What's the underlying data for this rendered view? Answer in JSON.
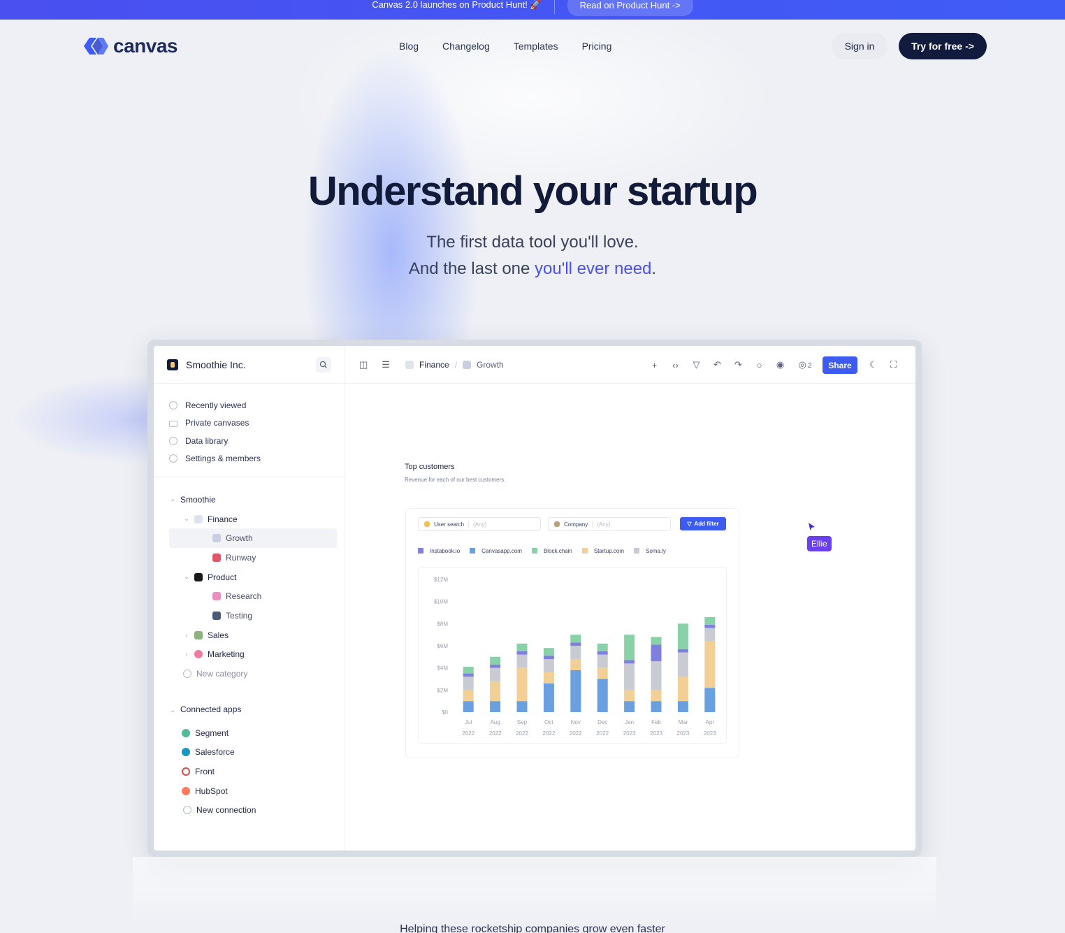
{
  "banner": {
    "announcement": "Canvas 2.0 launches on Product Hunt! 🚀",
    "cta": "Read on Product Hunt ->"
  },
  "nav": {
    "logo_text": "canvas",
    "links": [
      "Blog",
      "Changelog",
      "Templates",
      "Pricing"
    ],
    "sign_in": "Sign in",
    "try_free": "Try for free ->"
  },
  "hero": {
    "title": "Understand your startup",
    "line1": "The first data tool you'll love.",
    "line2_prefix": "And the last one ",
    "line2_accent": "you'll ever need",
    "line2_suffix": "."
  },
  "app": {
    "org_name": "Smoothie Inc.",
    "menu": [
      "Recently viewed",
      "Private canvases",
      "Data library",
      "Settings & members"
    ],
    "tree": {
      "workspace": "Smoothie",
      "finance": "Finance",
      "growth": "Growth",
      "runway": "Runway",
      "product": "Product",
      "research": "Research",
      "testing": "Testing",
      "sales": "Sales",
      "marketing": "Marketing",
      "new_category": "New category"
    },
    "apps_title": "Connected apps",
    "apps": [
      "Segment",
      "Salesforce",
      "Front",
      "HubSpot"
    ],
    "new_connection": "New connection",
    "breadcrumb": {
      "parent": "Finance",
      "current": "Growth",
      "sep": "/"
    },
    "viewers": "2",
    "share": "Share",
    "card_title": "Top customers",
    "card_subtitle": "Revenue for each of our best customers.",
    "filters": {
      "user_search": "User search",
      "company": "Company",
      "any": "(Any)",
      "add_filter": "Add filter"
    },
    "cursor_label": "Ellie"
  },
  "chart_data": {
    "type": "bar",
    "stacked": true,
    "categories": [
      "Jul 2022",
      "Aug 2022",
      "Sep 2022",
      "Oct 2022",
      "Nov 2022",
      "Dec 2022",
      "Jan 2023",
      "Feb 2023",
      "Mar 2023",
      "Apr 2023"
    ],
    "tick_months": [
      "Jul",
      "Aug",
      "Sep",
      "Oct",
      "Nov",
      "Dec",
      "Jan",
      "Feb",
      "Mar",
      "Apr"
    ],
    "tick_years": [
      "2022",
      "2022",
      "2022",
      "2022",
      "2022",
      "2022",
      "2023",
      "2023",
      "2023",
      "2023"
    ],
    "ylim": [
      0,
      12
    ],
    "y_ticks": [
      "$12M",
      "$10M",
      "$8M",
      "$6M",
      "$4M",
      "$2M",
      "$0"
    ],
    "y_tick_values": [
      12,
      10,
      8,
      6,
      4,
      2,
      0
    ],
    "legend_position": "top-left",
    "grid": false,
    "series": [
      {
        "name": "Canvasapp.com",
        "color": "#6a9fe0",
        "values": [
          1.0,
          1.0,
          1.0,
          2.6,
          3.8,
          3.0,
          1.0,
          1.0,
          1.0,
          2.2
        ]
      },
      {
        "name": "Startup.com",
        "color": "#f2cf95",
        "values": [
          1.0,
          1.8,
          3.0,
          1.0,
          1.0,
          1.0,
          1.0,
          1.0,
          2.2,
          4.2
        ]
      },
      {
        "name": "Soma.ly",
        "color": "#c9cbd2",
        "values": [
          1.2,
          1.2,
          1.2,
          1.2,
          1.2,
          1.2,
          2.4,
          2.6,
          2.2,
          1.2
        ]
      },
      {
        "name": "Instabook.io",
        "color": "#7f7fe0",
        "values": [
          0.3,
          0.3,
          0.3,
          0.3,
          0.3,
          0.3,
          0.3,
          1.5,
          0.3,
          0.3
        ]
      },
      {
        "name": "Block.chain",
        "color": "#89d1a9",
        "values": [
          0.6,
          0.7,
          0.7,
          0.7,
          0.7,
          0.7,
          2.3,
          0.7,
          2.3,
          0.7
        ]
      }
    ],
    "legend_order": [
      "Instabook.io",
      "Canvasapp.com",
      "Block.chain",
      "Startup.com",
      "Soma.ly"
    ]
  },
  "footer_teaser": "Helping these rocketship companies grow even faster"
}
